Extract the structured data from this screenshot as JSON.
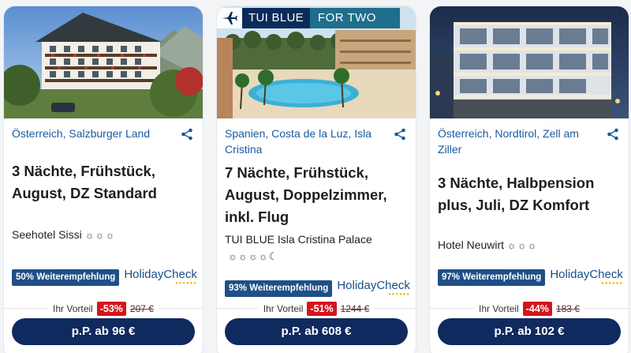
{
  "offers": [
    {
      "region": "Österreich, Salzburger Land",
      "title": "3 Nächte, Frühstück, August, DZ Standard",
      "hotel": "Seehotel Sissi",
      "stars": "☼☼☼",
      "recommendation": "50% Weiterempfehlung",
      "rating_brand": "HolidayCheck",
      "advantage_label": "Ihr Vorteil",
      "discount": "-53%",
      "old_price": "207 €",
      "cta": "p.P. ab 96 €"
    },
    {
      "badge_brand": "TUI BLUE",
      "badge_extra": "FOR TWO",
      "region": "Spanien, Costa de la Luz, Isla Cristina",
      "title": "7 Nächte, Frühstück, August, Doppelzimmer, inkl. Flug",
      "hotel": "TUI BLUE Isla Cristina Palace",
      "stars": "☼☼☼☼☾",
      "recommendation": "93% Weiterempfehlung",
      "rating_brand": "HolidayCheck",
      "advantage_label": "Ihr Vorteil",
      "discount": "-51%",
      "old_price": "1244 €",
      "cta": "p.P. ab 608 €"
    },
    {
      "region": "Österreich, Nordtirol, Zell am Ziller",
      "title": "3 Nächte, Halbpension plus, Juli, DZ Komfort",
      "hotel": "Hotel Neuwirt",
      "stars": "☼☼☼",
      "recommendation": "97% Weiterempfehlung",
      "rating_brand": "HolidayCheck",
      "advantage_label": "Ihr Vorteil",
      "discount": "-44%",
      "old_price": "183 €",
      "cta": "p.P. ab 102 €"
    }
  ],
  "icons": {
    "share": "share-icon",
    "plane": "plane-icon"
  },
  "colors": {
    "navy": "#0f2a5e",
    "link": "#1a5aa0",
    "discount": "#d4151c",
    "rec": "#1f4f86"
  }
}
